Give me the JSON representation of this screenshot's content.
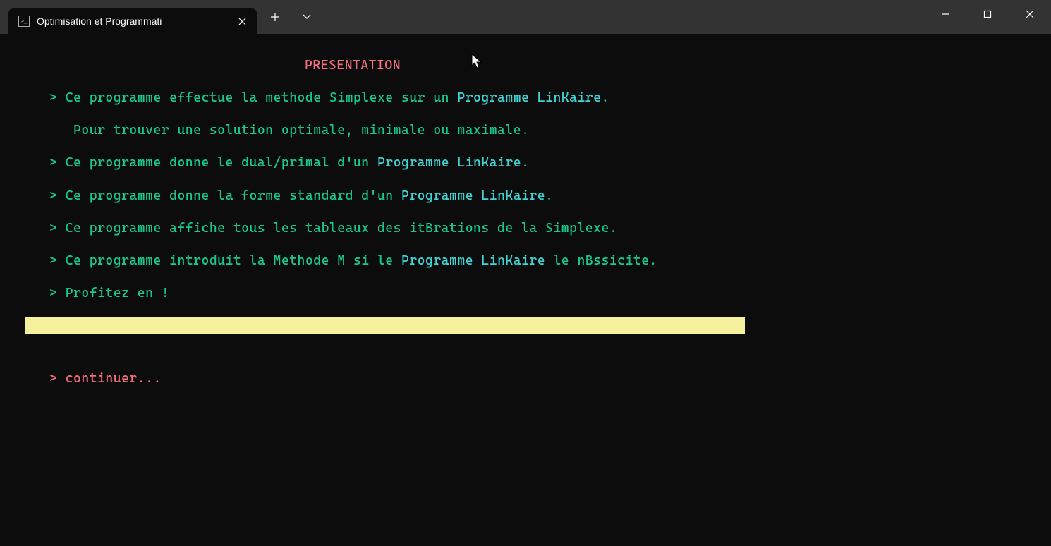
{
  "titlebar": {
    "tab_title": "Optimisation et Programmati",
    "tab_icon_text": ">_"
  },
  "terminal": {
    "heading": "PRESENTATION",
    "lines": [
      {
        "prefix": "   > ",
        "segments": [
          {
            "text": "Ce programme effectue la methode Simplexe sur un ",
            "cls": "green"
          },
          {
            "text": "Programme LinKaire",
            "cls": "cyan"
          },
          {
            "text": ".",
            "cls": "green"
          }
        ]
      },
      {
        "prefix": "      ",
        "segments": [
          {
            "text": "Pour trouver une solution optimale, minimale ou maximale.",
            "cls": "green"
          }
        ]
      },
      {
        "prefix": "   > ",
        "segments": [
          {
            "text": "Ce programme donne le dual/primal d'un ",
            "cls": "green"
          },
          {
            "text": "Programme LinKaire",
            "cls": "cyan"
          },
          {
            "text": ".",
            "cls": "green"
          }
        ]
      },
      {
        "prefix": "   > ",
        "segments": [
          {
            "text": "Ce programme donne la forme standard d'un ",
            "cls": "green"
          },
          {
            "text": "Programme LinKaire",
            "cls": "cyan"
          },
          {
            "text": ".",
            "cls": "green"
          }
        ]
      },
      {
        "prefix": "   > ",
        "segments": [
          {
            "text": "Ce programme affiche tous les tableaux des itBrations de la Simplexe.",
            "cls": "green"
          }
        ]
      },
      {
        "prefix": "   > ",
        "segments": [
          {
            "text": "Ce programme introduit la Methode M si le ",
            "cls": "green"
          },
          {
            "text": "Programme LinKaire",
            "cls": "cyan"
          },
          {
            "text": " le nBssicite.",
            "cls": "green"
          }
        ]
      },
      {
        "prefix": "   > ",
        "segments": [
          {
            "text": "Profitez en !",
            "cls": "green"
          }
        ]
      }
    ],
    "prompt_prefix": "   > ",
    "prompt_text": "continuer...",
    "bar_width_chars": 85
  },
  "colors": {
    "background": "#0c0c0c",
    "titlebar": "#333333",
    "green": "#16c98d",
    "red": "#f56e7e",
    "cyan": "#3fd5d5",
    "yellow": "#f4f09b"
  }
}
